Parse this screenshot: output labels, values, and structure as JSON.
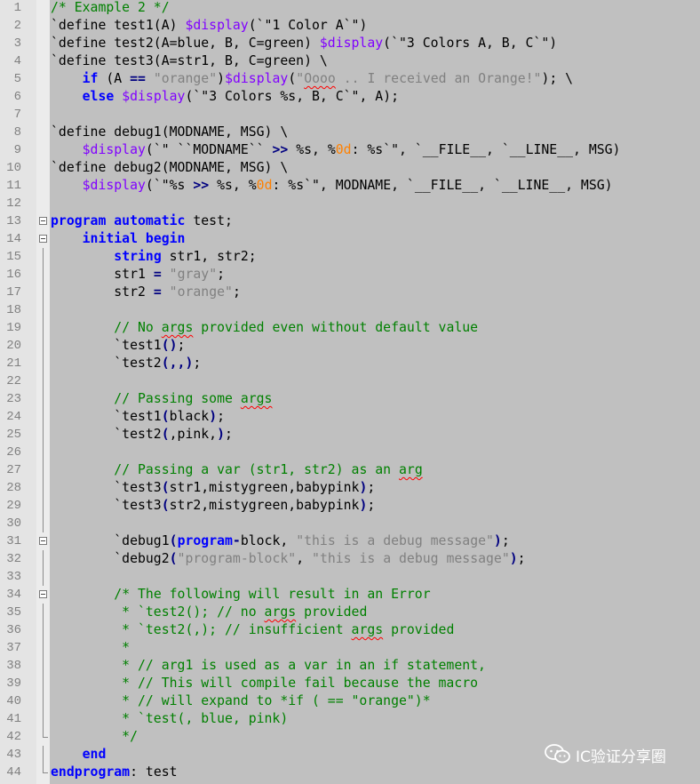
{
  "editor": {
    "lines": [
      [
        [
          "c",
          "/* Example 2 */"
        ]
      ],
      [
        [
          "t",
          "`define test1(A) "
        ],
        [
          "s",
          "$display"
        ],
        [
          "t",
          "(`\"1 Color A`\")"
        ]
      ],
      [
        [
          "t",
          "`define test2(A=blue, B, C=green) "
        ],
        [
          "s",
          "$display"
        ],
        [
          "t",
          "(`\"3 Colors A, B, C`\")"
        ]
      ],
      [
        [
          "t",
          "`define test3(A=str1, B, C=green) \\"
        ]
      ],
      [
        [
          "t",
          "    "
        ],
        [
          "k",
          "if"
        ],
        [
          "t",
          " (A "
        ],
        [
          "o",
          "=="
        ],
        [
          "t",
          " "
        ],
        [
          "g",
          "\"orange\""
        ],
        [
          "t",
          ")"
        ],
        [
          "s",
          "$display"
        ],
        [
          "t",
          "("
        ],
        [
          "g",
          "\""
        ],
        [
          "gq",
          "Oooo"
        ],
        [
          "g",
          " .. I received an Orange!\""
        ],
        [
          "t",
          "); \\"
        ]
      ],
      [
        [
          "t",
          "    "
        ],
        [
          "k",
          "else"
        ],
        [
          "t",
          " "
        ],
        [
          "s",
          "$display"
        ],
        [
          "t",
          "(`\"3 Colors %s, B, C`\", A);"
        ]
      ],
      [],
      [
        [
          "t",
          "`define debug1(MODNAME, MSG) \\"
        ]
      ],
      [
        [
          "t",
          "    "
        ],
        [
          "s",
          "$display"
        ],
        [
          "t",
          "(`\" ``MODNAME`` "
        ],
        [
          "o",
          ">>"
        ],
        [
          "t",
          " %s, %"
        ],
        [
          "n",
          "0d"
        ],
        [
          "t",
          ": %s`\", `__FILE__, `__LINE__, MSG)"
        ]
      ],
      [
        [
          "t",
          "`define debug2(MODNAME, MSG) \\"
        ]
      ],
      [
        [
          "t",
          "    "
        ],
        [
          "s",
          "$display"
        ],
        [
          "t",
          "(`\"%s "
        ],
        [
          "o",
          ">>"
        ],
        [
          "t",
          " %s, %"
        ],
        [
          "n",
          "0d"
        ],
        [
          "t",
          ": %s`\", MODNAME, `__FILE__, `__LINE__, MSG)"
        ]
      ],
      [],
      [
        [
          "k",
          "program automatic"
        ],
        [
          "t",
          " test;"
        ]
      ],
      [
        [
          "t",
          "    "
        ],
        [
          "k",
          "initial begin"
        ]
      ],
      [
        [
          "t",
          "        "
        ],
        [
          "k",
          "string"
        ],
        [
          "t",
          " str1, str2;"
        ]
      ],
      [
        [
          "t",
          "        str1 "
        ],
        [
          "o",
          "="
        ],
        [
          "t",
          " "
        ],
        [
          "g",
          "\"gray\""
        ],
        [
          "t",
          ";"
        ]
      ],
      [
        [
          "t",
          "        str2 "
        ],
        [
          "o",
          "="
        ],
        [
          "t",
          " "
        ],
        [
          "g",
          "\"orange\""
        ],
        [
          "t",
          ";"
        ]
      ],
      [],
      [
        [
          "t",
          "        "
        ],
        [
          "c",
          "// No "
        ],
        [
          "cq",
          "args"
        ],
        [
          "c",
          " provided even without default value"
        ]
      ],
      [
        [
          "t",
          "        `test1"
        ],
        [
          "o",
          "()"
        ],
        [
          "t",
          ";"
        ]
      ],
      [
        [
          "t",
          "        `test2"
        ],
        [
          "o",
          "(,,)"
        ],
        [
          "t",
          ";"
        ]
      ],
      [],
      [
        [
          "t",
          "        "
        ],
        [
          "c",
          "// Passing some "
        ],
        [
          "cq",
          "args"
        ]
      ],
      [
        [
          "t",
          "        `test1"
        ],
        [
          "o",
          "("
        ],
        [
          "t",
          "black"
        ],
        [
          "o",
          ")"
        ],
        [
          "t",
          ";"
        ]
      ],
      [
        [
          "t",
          "        `test2"
        ],
        [
          "o",
          "("
        ],
        [
          "t",
          ",pink,"
        ],
        [
          "o",
          ")"
        ],
        [
          "t",
          ";"
        ]
      ],
      [],
      [
        [
          "t",
          "        "
        ],
        [
          "c",
          "// Passing a var (str1, str2) as an "
        ],
        [
          "cq",
          "arg"
        ]
      ],
      [
        [
          "t",
          "        `test3"
        ],
        [
          "o",
          "("
        ],
        [
          "t",
          "str1,mistygreen,babypink"
        ],
        [
          "o",
          ")"
        ],
        [
          "t",
          ";"
        ]
      ],
      [
        [
          "t",
          "        `test3"
        ],
        [
          "o",
          "("
        ],
        [
          "t",
          "str2,mistygreen,babypink"
        ],
        [
          "o",
          ")"
        ],
        [
          "t",
          ";"
        ]
      ],
      [],
      [
        [
          "t",
          "        `debug1"
        ],
        [
          "o",
          "("
        ],
        [
          "k",
          "program"
        ],
        [
          "o",
          "-"
        ],
        [
          "t",
          "block, "
        ],
        [
          "g",
          "\"this is a debug message\""
        ],
        [
          "o",
          ")"
        ],
        [
          "t",
          ";"
        ]
      ],
      [
        [
          "t",
          "        `debug2"
        ],
        [
          "o",
          "("
        ],
        [
          "g",
          "\"program-block\""
        ],
        [
          "t",
          ", "
        ],
        [
          "g",
          "\"this is a debug message\""
        ],
        [
          "o",
          ")"
        ],
        [
          "t",
          ";"
        ]
      ],
      [],
      [
        [
          "t",
          "        "
        ],
        [
          "c",
          "/* The following will result in an Error"
        ]
      ],
      [
        [
          "c",
          "         * `test2(); // no "
        ],
        [
          "cq",
          "args"
        ],
        [
          "c",
          " provided"
        ]
      ],
      [
        [
          "c",
          "         * `test2(,); // insufficient "
        ],
        [
          "cq",
          "args"
        ],
        [
          "c",
          " provided"
        ]
      ],
      [
        [
          "c",
          "         *"
        ]
      ],
      [
        [
          "c",
          "         * // arg1 is used as a var in an if statement,"
        ]
      ],
      [
        [
          "c",
          "         * // This will compile fail because the macro"
        ]
      ],
      [
        [
          "c",
          "         * // will expand to *if ( == \"orange\")*"
        ]
      ],
      [
        [
          "c",
          "         * `test(, blue, pink)"
        ]
      ],
      [
        [
          "c",
          "         */"
        ]
      ],
      [
        [
          "t",
          "    "
        ],
        [
          "k",
          "end"
        ]
      ],
      [
        [
          "k",
          "endprogram"
        ],
        [
          "t",
          ": test"
        ]
      ]
    ],
    "fold_markers": {
      "13": "open",
      "14": "open",
      "31": "open",
      "34": "open"
    }
  },
  "watermark": {
    "icon": "wechat-icon",
    "text": "IC验证分享圈"
  },
  "colors": {
    "background": "#c0c0c0",
    "gutter": "#e4e4e4",
    "keyword": "#0000ff",
    "comment": "#008000",
    "string": "#808080",
    "system_task": "#8000ff",
    "number": "#ff8000",
    "operator": "#000080"
  }
}
